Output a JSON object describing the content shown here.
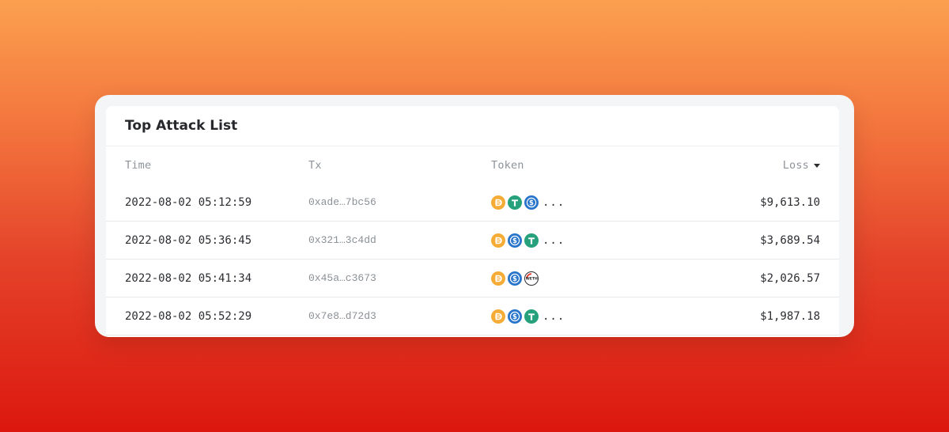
{
  "card": {
    "title": "Top Attack List"
  },
  "table": {
    "columns": {
      "time": "Time",
      "tx": "Tx",
      "token": "Token",
      "loss": "Loss"
    },
    "sort": {
      "column": "Loss",
      "direction": "desc"
    },
    "rows": [
      {
        "time": "2022-08-02 05:12:59",
        "tx": "0xade…7bc56",
        "tokens": [
          "DAI",
          "USDT",
          "USDC"
        ],
        "more": "...",
        "loss": "$9,613.10"
      },
      {
        "time": "2022-08-02 05:36:45",
        "tx": "0x321…3c4dd",
        "tokens": [
          "DAI",
          "USDC",
          "USDT"
        ],
        "more": "...",
        "loss": "$3,689.54"
      },
      {
        "time": "2022-08-02 05:41:34",
        "tx": "0x45a…c3673",
        "tokens": [
          "DAI",
          "USDC",
          "WETH"
        ],
        "more": "",
        "loss": "$2,026.57"
      },
      {
        "time": "2022-08-02 05:52:29",
        "tx": "0x7e8…d72d3",
        "tokens": [
          "DAI",
          "USDC",
          "USDT"
        ],
        "more": "...",
        "loss": "$1,987.18"
      }
    ]
  },
  "token_icons": {
    "DAI": "dai-icon",
    "USDT": "usdt-icon",
    "USDC": "usdc-icon",
    "WETH": "weth-icon"
  },
  "colors": {
    "DAI": "#f5ac37",
    "USDT": "#26a17b",
    "USDC": "#2775ca",
    "WETH": "#2b2d31"
  }
}
